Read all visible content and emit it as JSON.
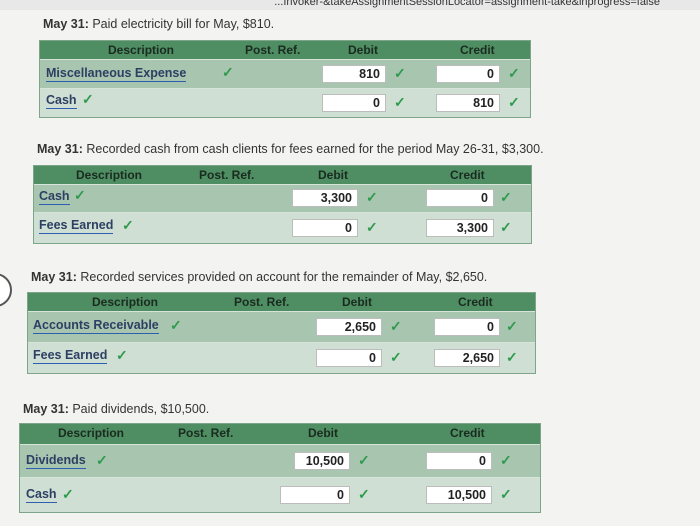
{
  "url_fragment": "...Invoker-&takeAssignmentSessionLocator=assignment-take&inprogress=false",
  "entries": [
    {
      "date": "May 31:",
      "text": "Paid electricity bill for May, $810.",
      "headers": {
        "description": "Description",
        "post_ref": "Post. Ref.",
        "debit": "Debit",
        "credit": "Credit"
      },
      "rows": [
        {
          "account": "Miscellaneous Expense",
          "debit": "810",
          "credit": "0"
        },
        {
          "account": "Cash",
          "debit": "0",
          "credit": "810"
        }
      ]
    },
    {
      "date": "May 31:",
      "text": "Recorded cash from cash clients for fees earned for the period May 26-31, $3,300.",
      "headers": {
        "description": "Description",
        "post_ref": "Post. Ref.",
        "debit": "Debit",
        "credit": "Credit"
      },
      "rows": [
        {
          "account": "Cash",
          "debit": "3,300",
          "credit": "0"
        },
        {
          "account": "Fees Earned",
          "debit": "0",
          "credit": "3,300"
        }
      ]
    },
    {
      "date": "May 31:",
      "text": "Recorded services provided on account for the remainder of May, $2,650.",
      "headers": {
        "description": "Description",
        "post_ref": "Post. Ref.",
        "debit": "Debit",
        "credit": "Credit"
      },
      "rows": [
        {
          "account": "Accounts Receivable",
          "debit": "2,650",
          "credit": "0"
        },
        {
          "account": "Fees Earned",
          "debit": "0",
          "credit": "2,650"
        }
      ]
    },
    {
      "date": "May 31:",
      "text": "Paid dividends, $10,500.",
      "headers": {
        "description": "Description",
        "post_ref": "Post. Ref.",
        "debit": "Debit",
        "credit": "Credit"
      },
      "rows": [
        {
          "account": "Dividends",
          "debit": "10,500",
          "credit": "0"
        },
        {
          "account": "Cash",
          "debit": "0",
          "credit": "10,500"
        }
      ]
    }
  ],
  "checkmark_icon": "check-icon",
  "colors": {
    "header_green": "#4f8d63",
    "row_green": "#a8c5b0",
    "check_green": "#2f9a4e",
    "account_blue": "#2d5fb0"
  }
}
